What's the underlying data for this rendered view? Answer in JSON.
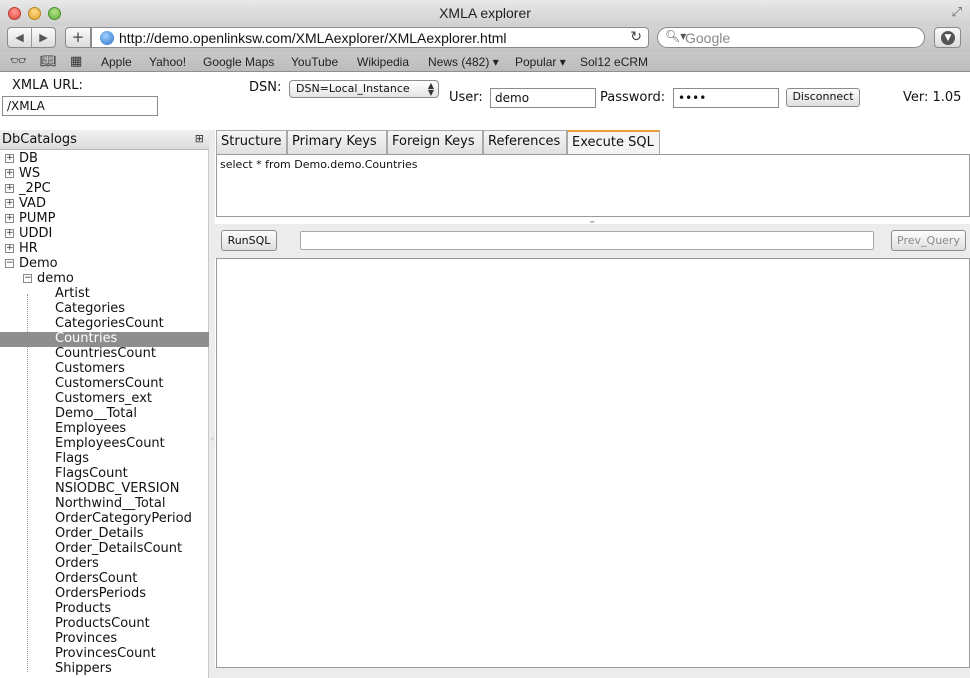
{
  "window": {
    "title": "XMLA explorer"
  },
  "browser": {
    "url": "http://demo.openlinksw.com/XMLAexplorer/XMLAexplorer.html",
    "search_placeholder": "Google",
    "bookmarks": [
      "Apple",
      "Yahoo!",
      "Google Maps",
      "YouTube",
      "Wikipedia",
      "News (482) ▾",
      "Popular ▾",
      "Sol12 eCRM"
    ],
    "icons": [
      "reading-list-icon",
      "bookmarks-book-icon",
      "top-sites-grid-icon"
    ]
  },
  "header": {
    "xmla_url_label": "XMLA URL:",
    "xmla_url_value": "/XMLA",
    "dsn_label": "DSN:",
    "dsn_value": "DSN=Local_Instance",
    "user_label": "User:",
    "user_value": "demo",
    "password_label": "Password:",
    "password_value": "••••",
    "disconnect_label": "Disconnect",
    "version": "Ver: 1.05"
  },
  "catalog": {
    "title": "DbCatalogs",
    "top_items": [
      "DB",
      "WS",
      "_2PC",
      "VAD",
      "PUMP",
      "UDDI",
      "HR"
    ],
    "expanded": "Demo",
    "schema": "demo",
    "tables": [
      "Artist",
      "Categories",
      "CategoriesCount",
      "Countries",
      "CountriesCount",
      "Customers",
      "CustomersCount",
      "Customers_ext",
      "Demo__Total",
      "Employees",
      "EmployeesCount",
      "Flags",
      "FlagsCount",
      "NSIODBC_VERSION",
      "Northwind__Total",
      "OrderCategoryPeriod",
      "Order_Details",
      "Order_DetailsCount",
      "Orders",
      "OrdersCount",
      "OrdersPeriods",
      "Products",
      "ProductsCount",
      "Provinces",
      "ProvincesCount",
      "Shippers"
    ],
    "selected": "Countries"
  },
  "tabs": [
    "Structure",
    "Primary Keys",
    "Foreign Keys",
    "References",
    "Execute SQL"
  ],
  "active_tab": "Execute SQL",
  "sql": {
    "query": "select * from Demo.demo.Countries",
    "run_label": "RunSQL",
    "prev_label": "Prev_Query",
    "history_value": ""
  },
  "colors": {
    "accent_tab": "#e8a13a",
    "selected_row": "#8e8e8e"
  }
}
